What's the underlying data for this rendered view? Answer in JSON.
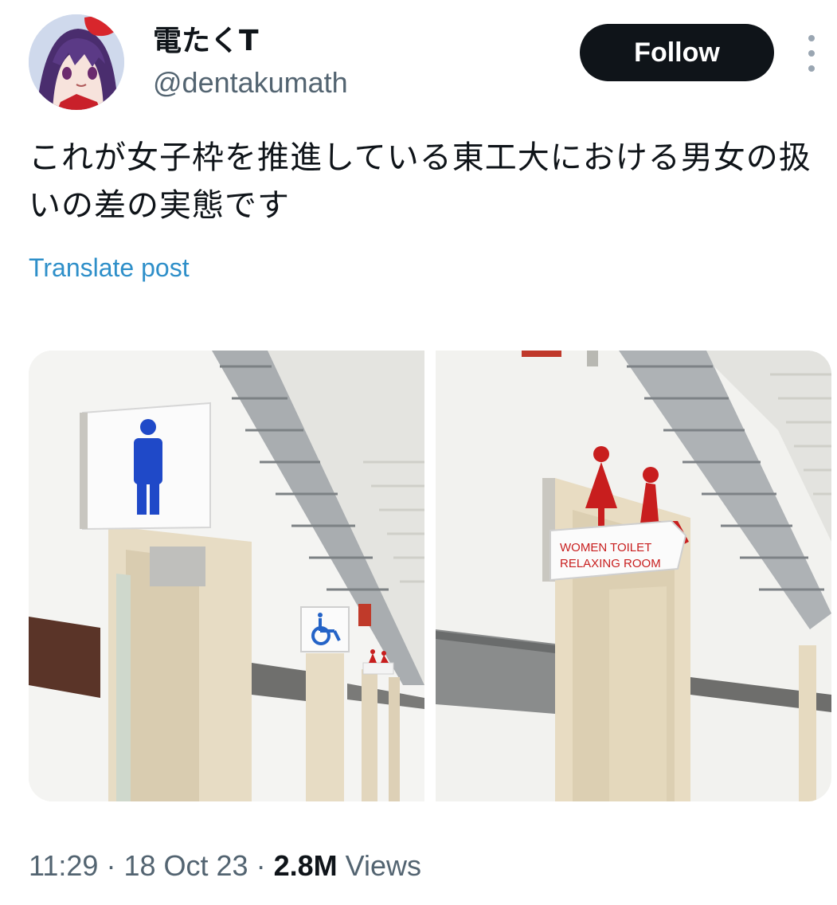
{
  "user": {
    "display_name": "電たくT",
    "handle": "@dentakumath",
    "avatar_icon": "anime-avatar-icon"
  },
  "actions": {
    "follow_label": "Follow",
    "more_icon": "more-vertical-icon"
  },
  "post": {
    "text": "これが女子枠を推進している東工大における男女の扱いの差の実態です",
    "translate_label": "Translate post"
  },
  "media": {
    "left_photo": {
      "description_icons": [
        "male-toilet-icon",
        "wheelchair-icon"
      ]
    },
    "right_photo": {
      "sign_line1": "WOMEN TOILET",
      "sign_line2": "RELAXING ROOM",
      "description_icons": [
        "female-toilet-icon",
        "female-seated-icon"
      ]
    }
  },
  "meta": {
    "time": "11:29",
    "date": "18 Oct 23",
    "separator": "·",
    "views_count": "2.8M",
    "views_label": "Views"
  },
  "colors": {
    "follow_bg": "#0f1419",
    "link": "#2e8fc9",
    "secondary_text": "#536471",
    "male_sign": "#1f49c8",
    "female_sign": "#c81e1e"
  }
}
